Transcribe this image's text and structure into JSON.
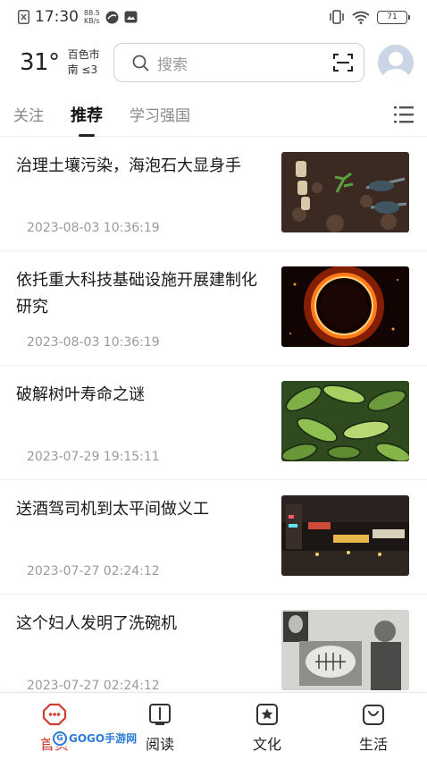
{
  "status_bar": {
    "time": "17:30",
    "net_speed_value": "88.5",
    "net_speed_unit": "KB/s",
    "battery": "71"
  },
  "header": {
    "temperature": "31°",
    "city": "百色市",
    "wind": "南  ≤3",
    "search_placeholder": "搜索"
  },
  "tabs": [
    {
      "label": "关注"
    },
    {
      "label": "推荐"
    },
    {
      "label": "学习强国"
    }
  ],
  "articles": [
    {
      "title": "治理土壤污染，海泡石大显身手",
      "time": "2023-08-03 10:36:19",
      "thumb": "soil-seedling-image"
    },
    {
      "title": "依托重大科技基础设施开展建制化研究",
      "time": "2023-08-03 10:36:19",
      "thumb": "fire-ring-image"
    },
    {
      "title": "破解树叶寿命之谜",
      "time": "2023-07-29 19:15:11",
      "thumb": "leaves-illustration-image"
    },
    {
      "title": "送酒驾司机到太平间做义工",
      "time": "2023-07-27 02:24:12",
      "thumb": "night-street-image"
    },
    {
      "title": "这个妇人发明了洗碗机",
      "time": "2023-07-27 02:24:12",
      "thumb": "vintage-photo-image"
    }
  ],
  "bottom_nav": [
    {
      "label": "首页"
    },
    {
      "label": "阅读"
    },
    {
      "label": "文化"
    },
    {
      "label": "生活"
    }
  ],
  "watermark": {
    "text": "GOGO手游网"
  },
  "colors": {
    "accent_red": "#d03b34",
    "text": "#1a1a1a",
    "muted": "#9a9a9a"
  }
}
